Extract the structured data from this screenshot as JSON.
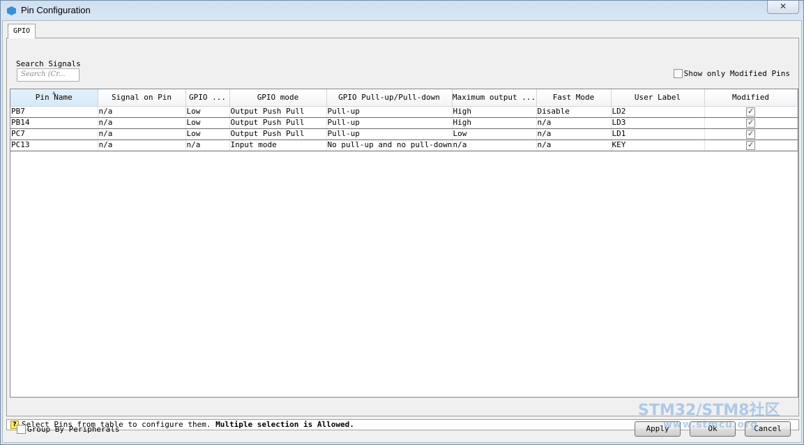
{
  "window": {
    "title": "Pin Configuration",
    "close_glyph": "✕"
  },
  "tabs": [
    {
      "label": "GPIO",
      "active": true
    }
  ],
  "search": {
    "label": "Search Signals",
    "placeholder": "Search (Cr..."
  },
  "show_only_modified": {
    "label": "Show only Modified Pins",
    "checked": false
  },
  "table": {
    "sorted_column": "Pin Name",
    "columns": [
      "Pin Name",
      "Signal on Pin",
      "GPIO ...",
      "GPIO mode",
      "GPIO Pull-up/Pull-down",
      "Maximum output ...",
      "Fast Mode",
      "User Label",
      "Modified"
    ],
    "rows": [
      {
        "pin": "PB7",
        "signal": "n/a",
        "gpio": "Low",
        "mode": "Output Push Pull",
        "pull": "Pull-up",
        "max_output": "High",
        "fast": "Disable",
        "label": "LD2",
        "modified": true
      },
      {
        "pin": "PB14",
        "signal": "n/a",
        "gpio": "Low",
        "mode": "Output Push Pull",
        "pull": "Pull-up",
        "max_output": "High",
        "fast": "n/a",
        "label": "LD3",
        "modified": true
      },
      {
        "pin": "PC7",
        "signal": "n/a",
        "gpio": "Low",
        "mode": "Output Push Pull",
        "pull": "Pull-up",
        "max_output": "Low",
        "fast": "n/a",
        "label": "LD1",
        "modified": true
      },
      {
        "pin": "PC13",
        "signal": "n/a",
        "gpio": "n/a",
        "mode": "Input mode",
        "pull": "No pull-up and no pull-down",
        "max_output": "n/a",
        "fast": "n/a",
        "label": "KEY",
        "modified": true
      }
    ]
  },
  "status": {
    "icon": "help-icon",
    "text": "Select Pins from table to configure them.",
    "bold_text": "Multiple selection is Allowed."
  },
  "group_by": {
    "label": "Group By Peripherals",
    "checked": false
  },
  "buttons": {
    "apply": "Apply",
    "ok": "Ok",
    "cancel": "Cancel"
  },
  "watermark": {
    "line1": "STM32/STM8社区",
    "line2": "www.stmcu.org"
  }
}
